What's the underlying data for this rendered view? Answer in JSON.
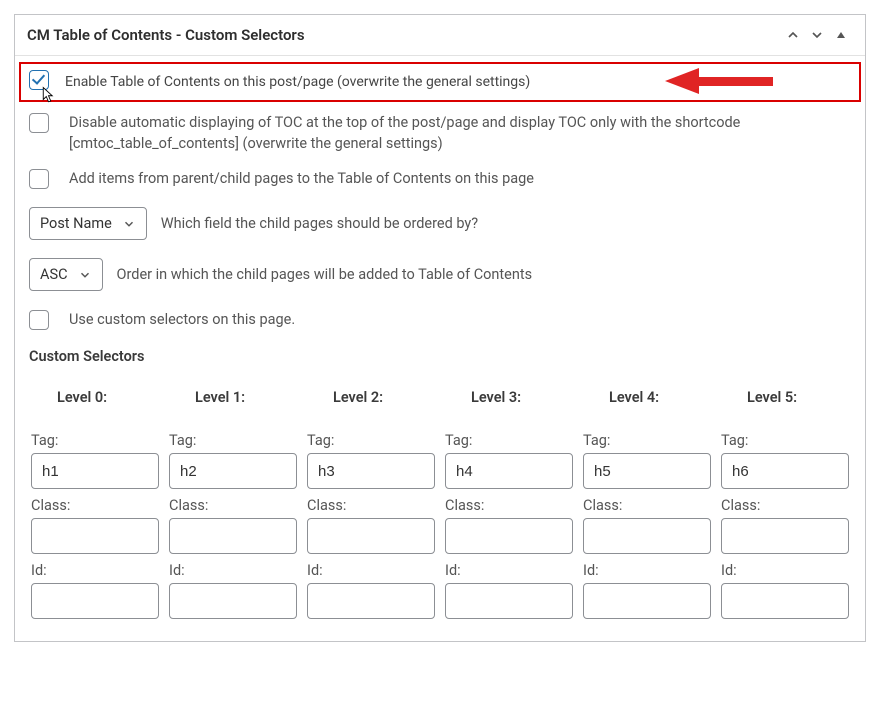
{
  "header": {
    "title": "CM Table of Contents - Custom Selectors"
  },
  "options": {
    "enable_label": "Enable Table of Contents on this post/page (overwrite the general settings)",
    "disable_auto_label": "Disable automatic displaying of TOC at the top of the post/page and display TOC only with the shortcode [cmtoc_table_of_contents] (overwrite the general settings)",
    "add_children_label": "Add items from parent/child pages to the Table of Contents on this page",
    "field_select_value": "Post Name",
    "field_select_desc": "Which field the child pages should be ordered by?",
    "order_select_value": "ASC",
    "order_select_desc": "Order in which the child pages will be added to Table of Contents",
    "use_custom_label": "Use custom selectors on this page."
  },
  "custom_selectors": {
    "title": "Custom Selectors",
    "tag_label": "Tag:",
    "class_label": "Class:",
    "id_label": "Id:",
    "levels": [
      {
        "title": "Level 0:",
        "tag": "h1",
        "class": "",
        "id": ""
      },
      {
        "title": "Level 1:",
        "tag": "h2",
        "class": "",
        "id": ""
      },
      {
        "title": "Level 2:",
        "tag": "h3",
        "class": "",
        "id": ""
      },
      {
        "title": "Level 3:",
        "tag": "h4",
        "class": "",
        "id": ""
      },
      {
        "title": "Level 4:",
        "tag": "h5",
        "class": "",
        "id": ""
      },
      {
        "title": "Level 5:",
        "tag": "h6",
        "class": "",
        "id": ""
      }
    ]
  }
}
